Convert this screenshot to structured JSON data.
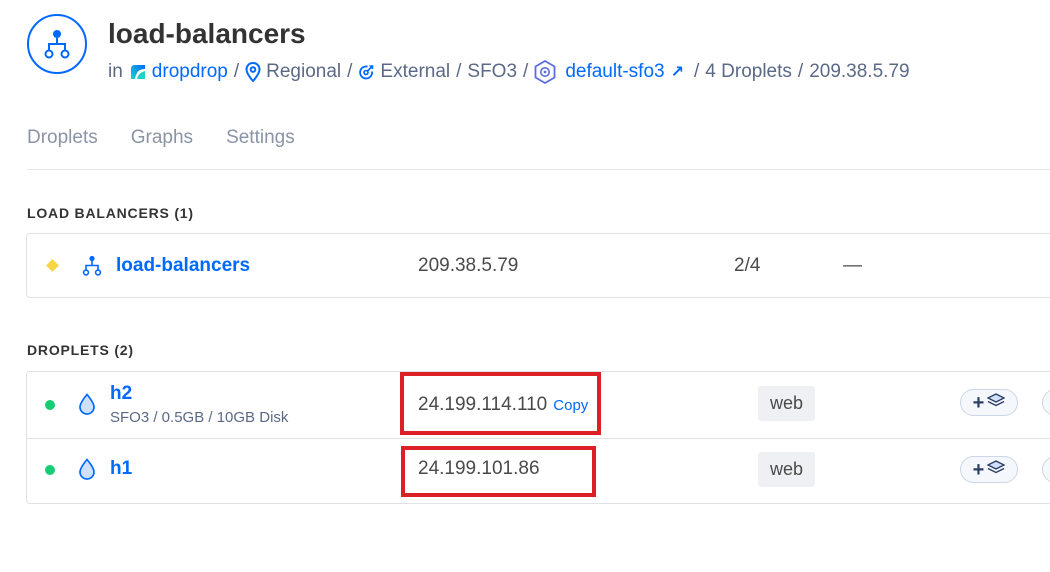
{
  "header": {
    "title": "load-balancers",
    "in_label": "in",
    "project_link": "dropdrop",
    "sep": "/",
    "region_scope": "Regional",
    "network_type": "External",
    "datacenter": "SFO3",
    "vpc_link": "default-sfo3",
    "external_arrow": "↗",
    "droplet_count": "4 Droplets",
    "ip": "209.38.5.79"
  },
  "tabs": [
    "Droplets",
    "Graphs",
    "Settings"
  ],
  "load_balancers": {
    "title": "LOAD BALANCERS (1)",
    "rows": [
      {
        "name": "load-balancers",
        "ip": "209.38.5.79",
        "health": "2/4",
        "extra": "—"
      }
    ]
  },
  "droplets": {
    "title": "DROPLETS (2)",
    "rows": [
      {
        "name": "h2",
        "subtitle": "SFO3 / 0.5GB / 10GB Disk",
        "ip": "24.199.114.110",
        "copy_label": "Copy",
        "tag": "web",
        "add_label": "+"
      },
      {
        "name": "h1",
        "subtitle": "",
        "ip": "24.199.101.86",
        "copy_label": "",
        "tag": "web",
        "add_label": "+"
      }
    ]
  },
  "colors": {
    "accent": "#0069ff",
    "status_active": "#15cd72",
    "lb_status": "#f5d543",
    "highlight": "#dd1f26"
  },
  "icons": {
    "header": "load-balancer-icon",
    "project": "project-icon",
    "region": "location-pin-icon",
    "network": "external-network-icon",
    "vpc": "vpc-icon",
    "droplet": "droplet-icon",
    "add_volume": "volume-icon"
  }
}
